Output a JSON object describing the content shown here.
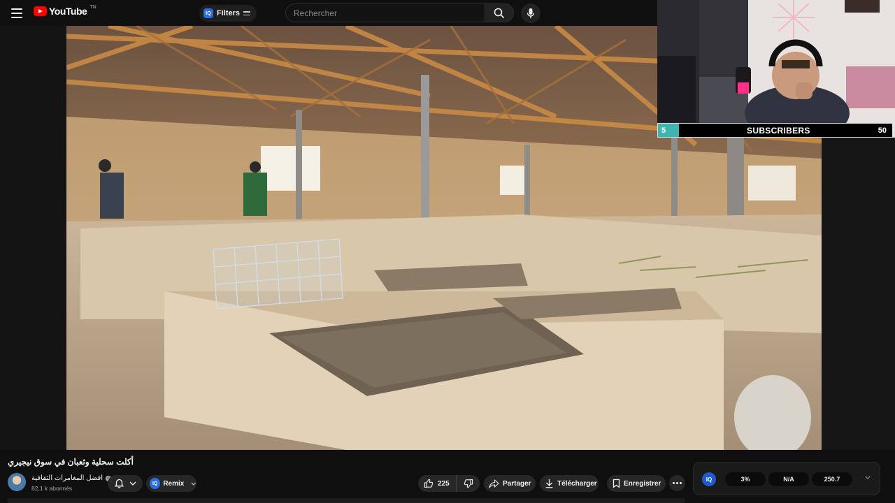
{
  "header": {
    "logo_text": "YouTube",
    "logo_sup": "TN",
    "filters_badge": "IQ",
    "filters_label": "Filters",
    "search_placeholder": "Rechercher"
  },
  "overlay": {
    "subscriber_current": "5",
    "subscriber_label": "SUBSCRIBERS",
    "subscriber_goal": "50",
    "subscriber_progress_fraction": 0.1
  },
  "video": {
    "title": "أكلت سحلية وثعبان في سوق نيجيري",
    "channel_name": "افضل المغامرات الثقافية",
    "subscribers": "82,1 k abonnés",
    "remix_badge": "IQ",
    "remix_label": "Remix",
    "like_count": "225",
    "share_label": "Partager",
    "download_label": "Télécharger",
    "save_label": "Enregistrer"
  },
  "iq_panel": {
    "logo": "IQ",
    "stats": [
      "3%",
      "N/A",
      "250.7"
    ]
  },
  "colors": {
    "background": "#0f0f0f",
    "brand_red": "#ff0000",
    "iq_blue": "#2a6ee0",
    "subscriber_fill": "#3fb5b0"
  }
}
